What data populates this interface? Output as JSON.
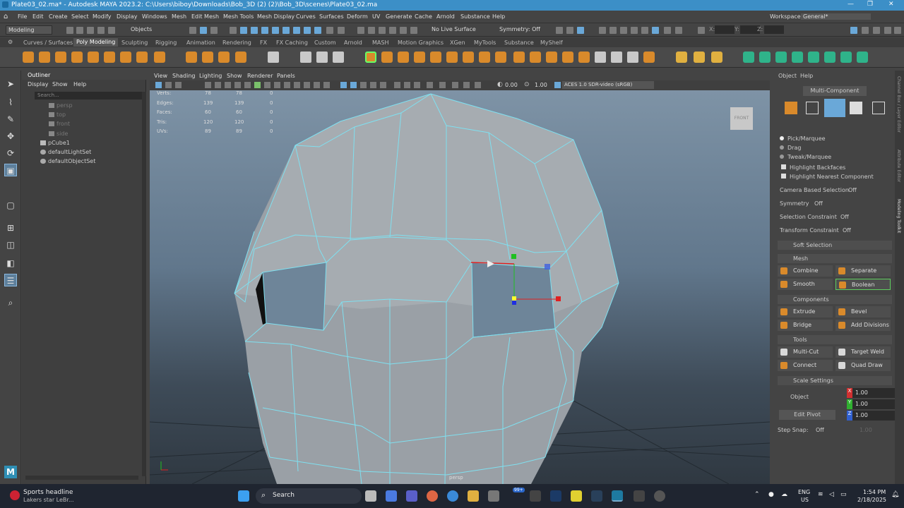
{
  "window": {
    "title": "Plate03_02.ma* - Autodesk MAYA 2023.2: C:\\Users\\biboy\\Downloads\\Bob_3D (2) (2)\\Bob_3D\\scenes\\Plate03_02.ma",
    "controls": [
      "—",
      "❐",
      "✕"
    ]
  },
  "menubar": {
    "items": [
      "File",
      "Edit",
      "Create",
      "Select",
      "Modify",
      "Display",
      "Windows",
      "Mesh",
      "Edit Mesh",
      "Mesh Tools",
      "Mesh Display",
      "Curves",
      "Surfaces",
      "Deform",
      "UV",
      "Generate",
      "Cache",
      "Arnold",
      "Substance",
      "Help"
    ],
    "workspace_label": "Workspace:",
    "workspace_value": "General*"
  },
  "statusline": {
    "mode": "Modeling",
    "objects": "Objects",
    "live_surface": "No Live Surface",
    "symmetry": "Symmetry: Off",
    "x_label": "X:",
    "y_label": "Y:",
    "z_label": "Z:"
  },
  "shelf": {
    "tabs": [
      "Curves / Surfaces",
      "Poly Modeling",
      "Sculpting",
      "Rigging",
      "Animation",
      "Rendering",
      "FX",
      "FX Caching",
      "Custom",
      "Arnold",
      "MASH",
      "Motion Graphics",
      "XGen",
      "MyTools",
      "Substance",
      "MyShelf"
    ],
    "active_tab": "Poly Modeling"
  },
  "outliner": {
    "title": "Outliner",
    "menu": [
      "Display",
      "Show",
      "Help"
    ],
    "search_placeholder": "Search...",
    "items": [
      {
        "label": "persp",
        "dim": true
      },
      {
        "label": "top",
        "dim": true
      },
      {
        "label": "front",
        "dim": true
      },
      {
        "label": "side",
        "dim": true
      },
      {
        "label": "pCube1",
        "dim": false
      },
      {
        "label": "defaultLightSet",
        "dim": false
      },
      {
        "label": "defaultObjectSet",
        "dim": false
      }
    ]
  },
  "viewport": {
    "menu": [
      "View",
      "Shading",
      "Lighting",
      "Show",
      "Renderer",
      "Panels"
    ],
    "exposure": "0.00",
    "gamma": "1.00",
    "colorspace": "ACES 1.0 SDR-video (sRGB)",
    "camera_label": "persp",
    "view_cube": "FRONT",
    "hud": [
      {
        "label": "Verts:",
        "a": "78",
        "b": "78",
        "c": "0"
      },
      {
        "label": "Edges:",
        "a": "139",
        "b": "139",
        "c": "0"
      },
      {
        "label": "Faces:",
        "a": "60",
        "b": "60",
        "c": "0"
      },
      {
        "label": "Tris:",
        "a": "120",
        "b": "120",
        "c": "0"
      },
      {
        "label": "UVs:",
        "a": "89",
        "b": "89",
        "c": "0"
      }
    ],
    "colors": {
      "wire": "#7fe0f0",
      "mesh": "#9aa0a6"
    }
  },
  "modeling_toolkit": {
    "menu": [
      "Object",
      "Help"
    ],
    "mode_button": "Multi-Component",
    "pick_marquee": "Pick/Marquee",
    "drag": "Drag",
    "tweak_marquee": "Tweak/Marquee",
    "highlight_backfaces": "Highlight Backfaces",
    "highlight_nearest": "Highlight Nearest Component",
    "camera_based_selection": "Camera Based Selection",
    "camera_based_value": "Off",
    "symmetry": "Symmetry",
    "symmetry_value": "Off",
    "selection_constraint": "Selection Constraint",
    "selection_constraint_value": "Off",
    "transform_constraint": "Transform Constraint",
    "transform_constraint_value": "Off",
    "soft_selection": "Soft Selection",
    "mesh_section": "Mesh",
    "combine": "Combine",
    "separate": "Separate",
    "smooth": "Smooth",
    "boolean": "Boolean",
    "components_section": "Components",
    "extrude": "Extrude",
    "bevel": "Bevel",
    "bridge": "Bridge",
    "add_divisions": "Add Divisions",
    "tools_section": "Tools",
    "multi_cut": "Multi-Cut",
    "target_weld": "Target Weld",
    "connect": "Connect",
    "quad_draw": "Quad Draw",
    "scale_settings": "Scale Settings",
    "object": "Object",
    "edit_pivot": "Edit Pivot",
    "x_val": "1.00",
    "y_val": "1.00",
    "z_val": "1.00",
    "step_snap": "Step Snap:",
    "step_snap_value": "Off",
    "step_value": "1.00",
    "side_tabs": [
      "Channel Box / Layer Editor",
      "Attribute Editor",
      "Modeling Toolkit"
    ]
  },
  "taskbar": {
    "news_title": "Sports headline",
    "news_sub": "Lakers star LeBr...",
    "search": "Search",
    "lang1": "ENG",
    "lang2": "US",
    "time": "1:54 PM",
    "date": "2/18/2025",
    "badge": "99+"
  }
}
